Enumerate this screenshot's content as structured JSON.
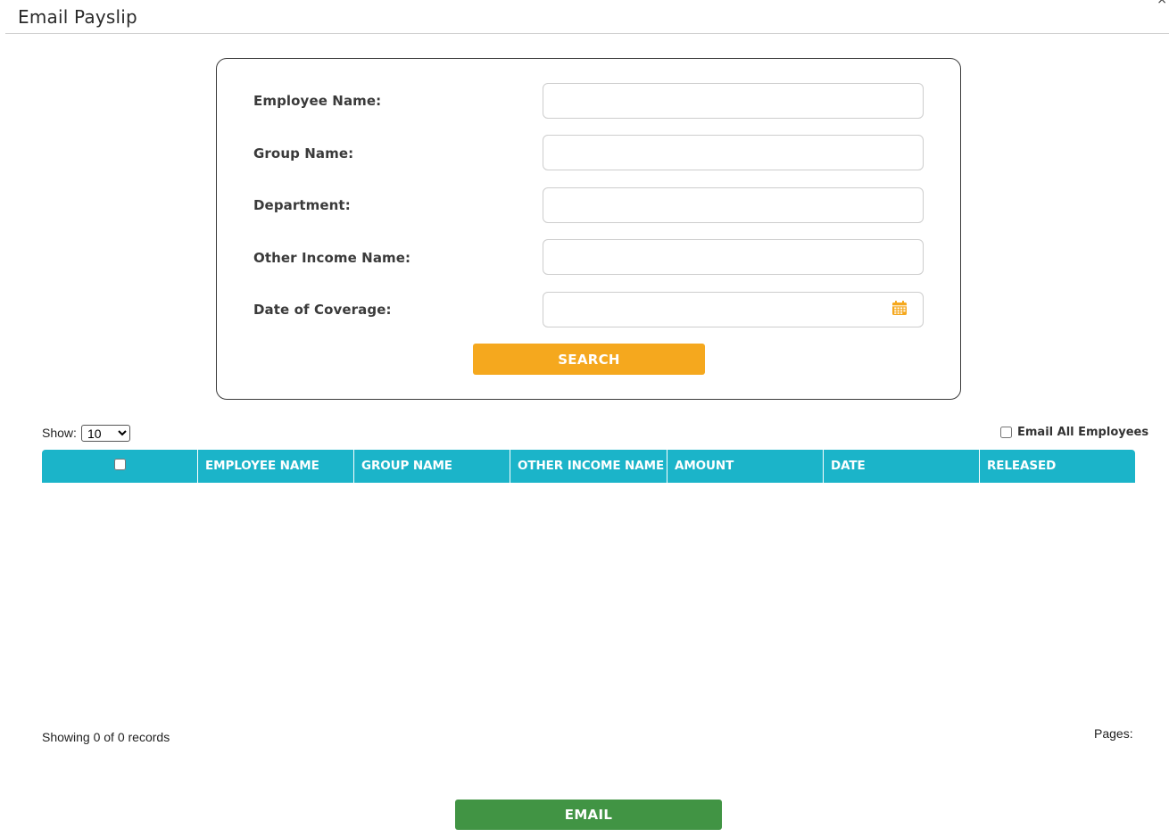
{
  "modal": {
    "title": "Email Payslip",
    "close_symbol": "×"
  },
  "search_form": {
    "fields": [
      {
        "label": "Employee Name:",
        "value": "",
        "placeholder": ""
      },
      {
        "label": "Group Name:",
        "value": "",
        "placeholder": ""
      },
      {
        "label": "Department:",
        "value": "",
        "placeholder": ""
      },
      {
        "label": "Other Income Name:",
        "value": "",
        "placeholder": ""
      },
      {
        "label": "Date of Coverage:",
        "value": "",
        "placeholder": ""
      }
    ],
    "calendar_icon": "calendar-icon",
    "search_label": "SEARCH"
  },
  "table_controls": {
    "show_label": "Show:",
    "page_size": "10",
    "email_all_label": "Email All Employees"
  },
  "table": {
    "columns": [
      "EMPLOYEE NAME",
      "GROUP NAME",
      "OTHER INCOME NAME",
      "AMOUNT",
      "DATE",
      "RELEASED"
    ],
    "rows": []
  },
  "footer": {
    "records_info": "Showing 0 of 0 records",
    "pages_label": "Pages:"
  },
  "actions": {
    "email_label": "EMAIL"
  },
  "colors": {
    "search_button": "#f5a81e",
    "table_header": "#1bb4c9",
    "email_button": "#419444",
    "calendar_icon": "#f5a81e"
  }
}
